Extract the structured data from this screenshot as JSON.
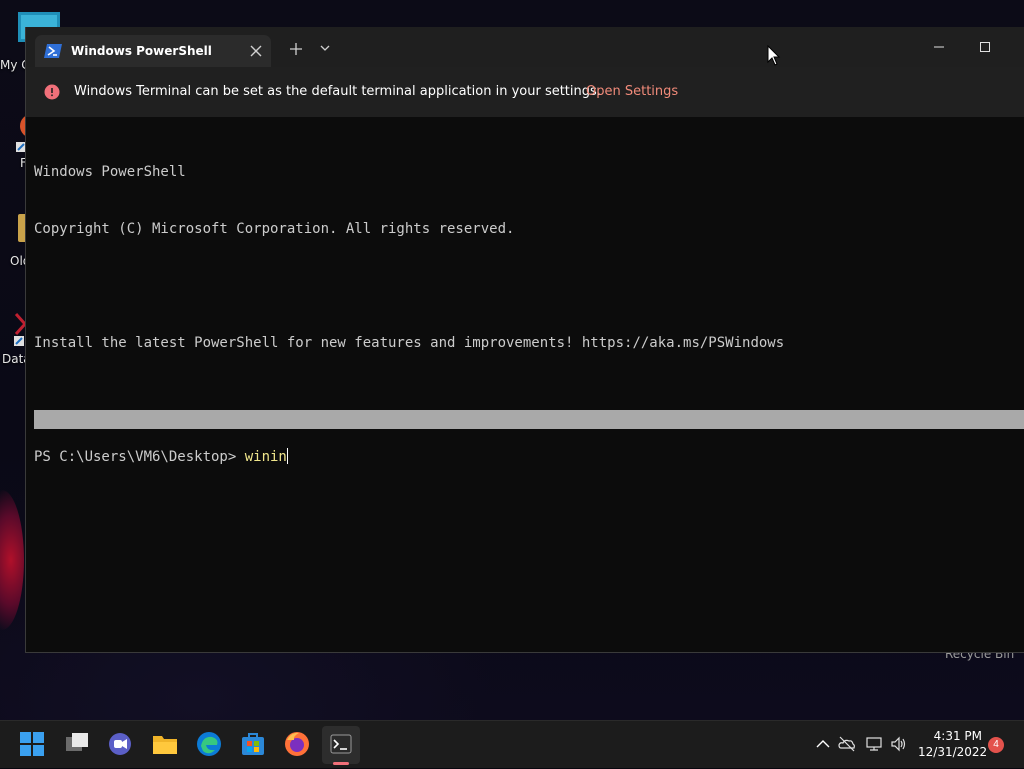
{
  "desktop": {
    "icons": [
      {
        "label": "My C"
      },
      {
        "label": "F"
      },
      {
        "label": "Old"
      },
      {
        "label": "Data"
      }
    ],
    "recycle_label": "Recycle Bin"
  },
  "window": {
    "tab_title": "Windows PowerShell",
    "banner": {
      "message": "Windows Terminal can be set as the default terminal application in your settings.",
      "link": "Open Settings"
    },
    "console": {
      "line1": "Windows PowerShell",
      "line2": "Copyright (C) Microsoft Corporation. All rights reserved.",
      "line3": "Install the latest PowerShell for new features and improvements! https://aka.ms/PSWindows",
      "prompt": "PS C:\\Users\\VM6\\Desktop> ",
      "command": "winin"
    }
  },
  "taskbar": {
    "apps": [
      "start-icon",
      "task-view-icon",
      "chat-icon",
      "file-explorer-icon",
      "edge-icon",
      "store-icon",
      "firefox-icon",
      "terminal-icon"
    ],
    "time": "4:31 PM",
    "date": "12/31/2022",
    "notification_count": "4"
  },
  "colors": {
    "link": "#f28b7a",
    "command": "#f0e68c",
    "info_icon": "#f1707a"
  }
}
